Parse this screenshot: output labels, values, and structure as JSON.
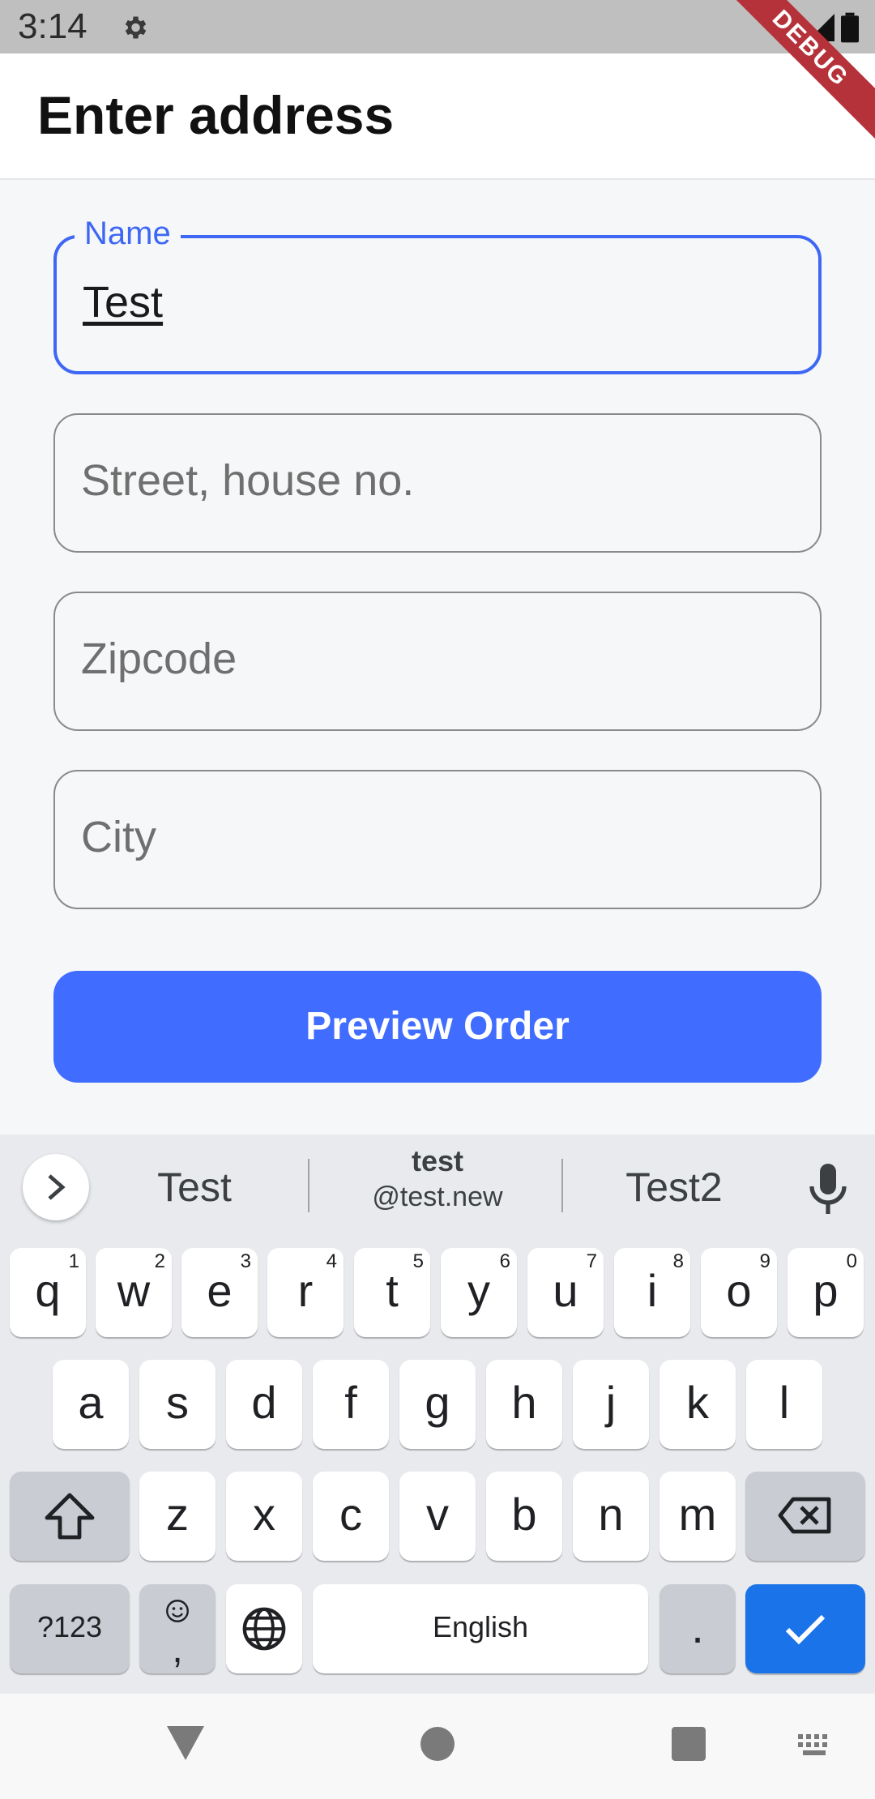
{
  "status_bar": {
    "time": "3:14",
    "debug_label": "DEBUG"
  },
  "app_bar": {
    "title": "Enter address"
  },
  "form": {
    "name_label": "Name",
    "name_value": "Test",
    "street_placeholder": "Street, house no.",
    "zipcode_placeholder": "Zipcode",
    "city_placeholder": "City",
    "preview_button": "Preview Order"
  },
  "keyboard": {
    "suggestions": {
      "left": "Test",
      "middle_title": "test",
      "middle_subtitle": "@test.new",
      "right": "Test2"
    },
    "row1": [
      {
        "k": "q",
        "h": "1"
      },
      {
        "k": "w",
        "h": "2"
      },
      {
        "k": "e",
        "h": "3"
      },
      {
        "k": "r",
        "h": "4"
      },
      {
        "k": "t",
        "h": "5"
      },
      {
        "k": "y",
        "h": "6"
      },
      {
        "k": "u",
        "h": "7"
      },
      {
        "k": "i",
        "h": "8"
      },
      {
        "k": "o",
        "h": "9"
      },
      {
        "k": "p",
        "h": "0"
      }
    ],
    "row2": [
      "a",
      "s",
      "d",
      "f",
      "g",
      "h",
      "j",
      "k",
      "l"
    ],
    "row3": [
      "z",
      "x",
      "c",
      "v",
      "b",
      "n",
      "m"
    ],
    "symbols_key": "?123",
    "emoji_comma_key": ",",
    "space_key": "English",
    "period_key": ".",
    "colors": {
      "accent": "#1a73e8",
      "form_accent": "#3d67f4",
      "button": "#406cff"
    }
  },
  "icons": {
    "status": [
      "gear-icon",
      "wifi-icon",
      "signal-icon",
      "battery-icon"
    ],
    "keyboard": [
      "chevron-right-icon",
      "mic-icon",
      "shift-icon",
      "backspace-icon",
      "emoji-icon",
      "globe-icon",
      "check-icon"
    ],
    "nav": [
      "back-icon",
      "home-icon",
      "recents-icon",
      "keyboard-switch-icon"
    ]
  }
}
